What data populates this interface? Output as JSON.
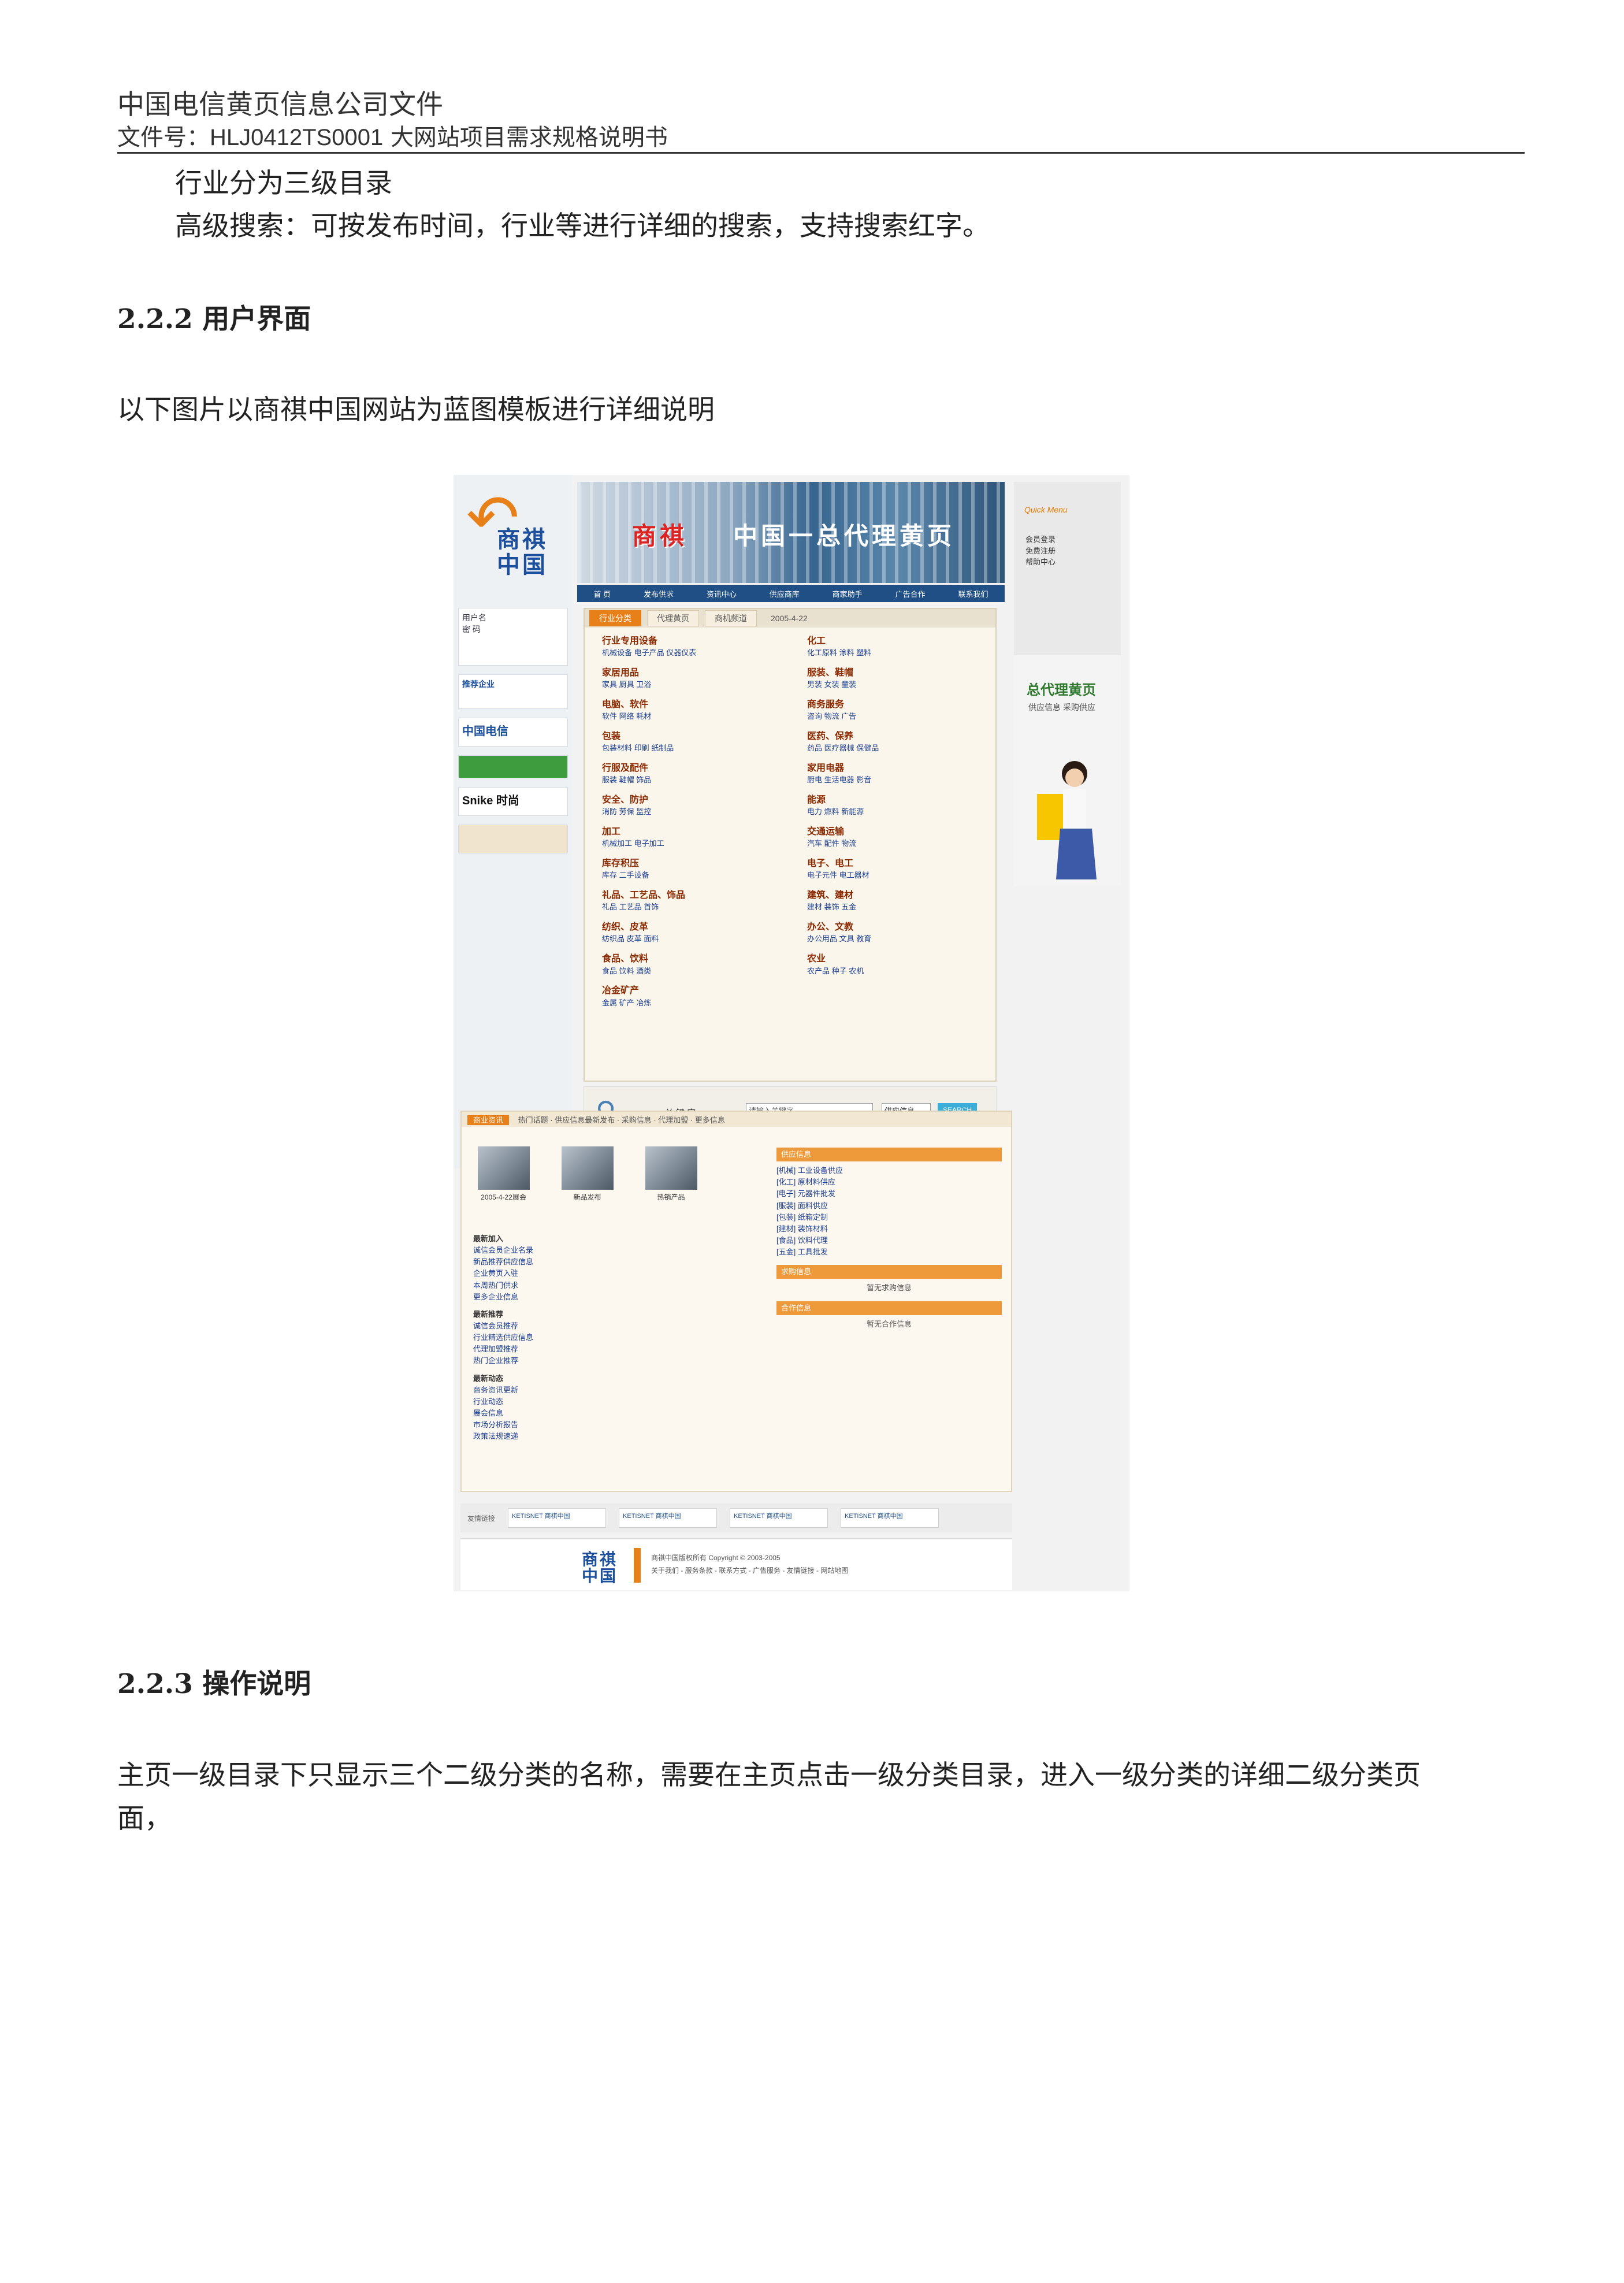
{
  "header": {
    "company": "中国电信黄页信息公司文件",
    "doc_prefix": "文件号：",
    "doc_id": "HLJ0412TS0001",
    "doc_title": "大网站项目需求规格说明书"
  },
  "body": {
    "line1": "行业分为三级目录",
    "line2": "高级搜索：可按发布时间，行业等进行详细的搜索，支持搜索红字。",
    "sec_222": "2.2.2 用户界面",
    "intro": "以下图片以商祺中国网站为蓝图模板进行详细说明",
    "sec_223": "2.2.3 操作说明",
    "op_line1": "主页一级目录下只显示三个二级分类的名称，需要在主页点击一级分类目录，进入一级分类的详细二级分类页",
    "op_line2": "面，"
  },
  "screenshot": {
    "logo": "商祺中国",
    "banner_brand": "商祺",
    "banner_slogan": "中国一总代理黄页",
    "nav": [
      "首 页",
      "发布供求",
      "资讯中心",
      "供应商库",
      "商家助手",
      "广告合作",
      "联系我们"
    ],
    "quick_menu": "Quick Menu",
    "quick_links": [
      "会员登录",
      "免费注册",
      "帮助中心"
    ],
    "agent_title": "总代理黄页",
    "agent_sub": "供应信息  采购供应",
    "side_login": "用户名\n密 码",
    "side_recommend": "推荐企业",
    "side_brands": [
      "中国电信",
      "Snike 时尚"
    ],
    "tabs": [
      "行业分类",
      "代理黄页",
      "商机频道"
    ],
    "date": "2005-4-22",
    "cats_left": [
      {
        "h": "行业专用设备",
        "s": "机械设备  电子产品  仪器仪表"
      },
      {
        "h": "家居用品",
        "s": "家具  厨具  卫浴"
      },
      {
        "h": "电脑、软件",
        "s": "软件  网络  耗材"
      },
      {
        "h": "包装",
        "s": "包装材料  印刷  纸制品"
      },
      {
        "h": "行服及配件",
        "s": "服装  鞋帽  饰品"
      },
      {
        "h": "安全、防护",
        "s": "消防  劳保  监控"
      },
      {
        "h": "加工",
        "s": "机械加工  电子加工"
      },
      {
        "h": "库存积压",
        "s": "库存  二手设备"
      },
      {
        "h": "礼品、工艺品、饰品",
        "s": "礼品  工艺品  首饰"
      },
      {
        "h": "纺织、皮革",
        "s": "纺织品  皮革  面料"
      },
      {
        "h": "食品、饮料",
        "s": "食品  饮料  酒类"
      },
      {
        "h": "冶金矿产",
        "s": "金属  矿产  冶炼"
      }
    ],
    "cats_right": [
      {
        "h": "化工",
        "s": "化工原料  涂料  塑料"
      },
      {
        "h": "服装、鞋帽",
        "s": "男装  女装  童装"
      },
      {
        "h": "商务服务",
        "s": "咨询  物流  广告"
      },
      {
        "h": "医药、保养",
        "s": "药品  医疗器械  保健品"
      },
      {
        "h": "家用电器",
        "s": "厨电  生活电器  影音"
      },
      {
        "h": "能源",
        "s": "电力  燃料  新能源"
      },
      {
        "h": "交通运输",
        "s": "汽车  配件  物流"
      },
      {
        "h": "电子、电工",
        "s": "电子元件  电工器材"
      },
      {
        "h": "建筑、建材",
        "s": "建材  装饰  五金"
      },
      {
        "h": "办公、文教",
        "s": "办公用品  文具  教育"
      },
      {
        "h": "农业",
        "s": "农产品  种子  农机"
      }
    ],
    "search_label": "关 键 字",
    "search_placeholder": "请输入关键字...",
    "search_select": "供应信息",
    "search_button": "SEARCH",
    "lower_tag": "商业资讯",
    "lower_ticker": "热门话题 · 供应信息最新发布 · 采购信息 · 代理加盟 · 更多信息",
    "thumbs": [
      "2005-4-22展会",
      "新品发布",
      "热销产品"
    ],
    "left_lists": [
      {
        "h": "最新加入",
        "items": [
          "诚信会员企业名录",
          "新品推荐供应信息",
          "企业黄页入驻",
          "本周热门供求",
          "更多企业信息"
        ]
      },
      {
        "h": "最新推荐",
        "items": [
          "诚信会员推荐",
          "行业精选供应信息",
          "代理加盟推荐",
          "热门企业推荐"
        ]
      },
      {
        "h": "最新动态",
        "items": [
          "商务资讯更新",
          "行业动态",
          "展会信息",
          "市场分析报告",
          "政策法规速递"
        ]
      }
    ],
    "right_bars": [
      "供应信息",
      "求购信息",
      "合作信息"
    ],
    "right_items": [
      "[机械] 工业设备供应",
      "[化工] 原材料供应",
      "[电子] 元器件批发",
      "[服装] 面料供应",
      "[包装] 纸箱定制",
      "[建材] 装饰材料",
      "[食品] 饮料代理",
      "[五金] 工具批发"
    ],
    "right_center1": "暂无求购信息",
    "right_center2": "暂无合作信息",
    "partners_label": "友情链接",
    "partner_boxes": [
      "KETISNET 商祺中国",
      "KETISNET 商祺中国",
      "KETISNET 商祺中国",
      "KETISNET 商祺中国"
    ],
    "footer_logo": "商祺中国",
    "footer_copy": "商祺中国版权所有 Copyright © 2003-2005",
    "footer_links": "关于我们 - 服务条款 - 联系方式 - 广告服务 - 友情链接 - 网站地图"
  }
}
